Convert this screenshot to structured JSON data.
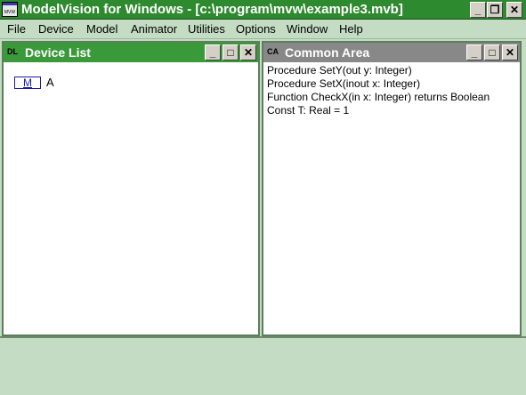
{
  "app": {
    "icon_label": "MVW",
    "title": "ModelVision for Windows - [c:\\program\\mvw\\example3.mvb]"
  },
  "window_controls": {
    "minimize": "_",
    "restore": "❐",
    "close": "✕"
  },
  "menu": [
    "File",
    "Device",
    "Model",
    "Animator",
    "Utilities",
    "Options",
    "Window",
    "Help"
  ],
  "device_list": {
    "icon": "DL",
    "title": "Device List",
    "items": [
      {
        "box": "M",
        "label": "A"
      }
    ]
  },
  "common_area": {
    "icon": "CA",
    "title": "Common Area",
    "lines": [
      "Procedure SetY(out y: Integer)",
      "Procedure SetX(inout x: Integer)",
      "Function CheckX(in x: Integer) returns Boolean",
      "Const  T: Real = 1"
    ]
  },
  "mdi_controls": {
    "minimize": "_",
    "maximize": "□",
    "close": "✕"
  }
}
